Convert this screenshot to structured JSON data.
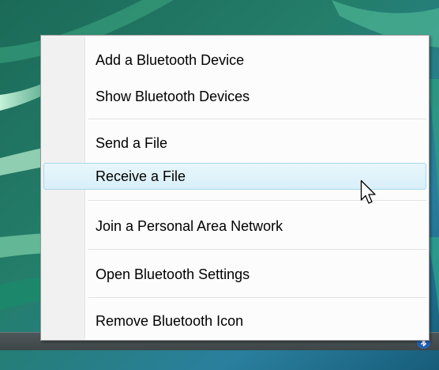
{
  "menu": {
    "items": [
      {
        "label": "Add a Bluetooth Device"
      },
      {
        "label": "Show Bluetooth Devices"
      },
      {
        "label": "Send a File"
      },
      {
        "label": "Receive a File",
        "highlighted": true
      },
      {
        "label": "Join a Personal Area Network"
      },
      {
        "label": "Open Bluetooth Settings"
      },
      {
        "label": "Remove Bluetooth Icon"
      }
    ],
    "highlight_color": "#d9eff9",
    "highlight_border_color": "#a8d8eb"
  },
  "system_tray": {
    "icon": "bluetooth-icon"
  },
  "pointer": {
    "icon": "mouse-pointer-icon"
  },
  "desktop": {
    "wallpaper_colors": [
      "#1f6f5a",
      "#6fc6a0",
      "#2f7fb3"
    ]
  }
}
